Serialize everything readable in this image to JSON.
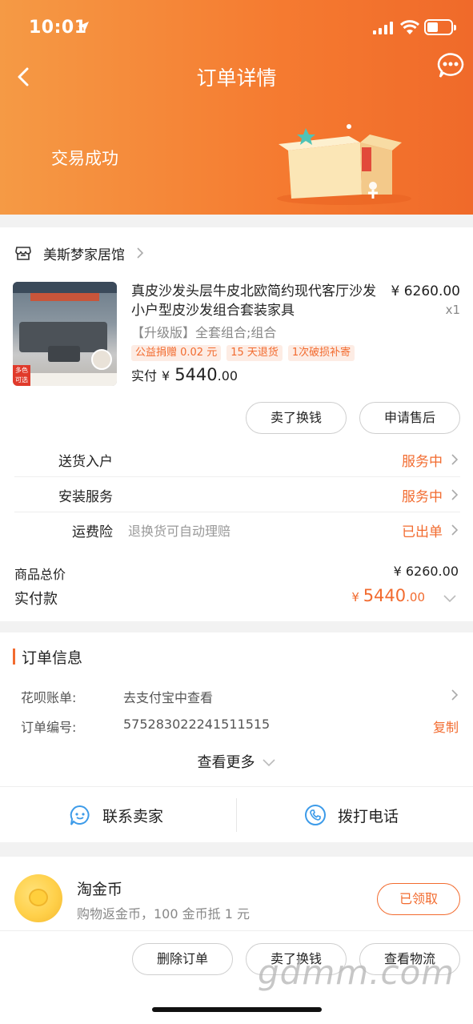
{
  "status_bar": {
    "time": "10:01"
  },
  "nav": {
    "title": "订单详情"
  },
  "header": {
    "status": "交易成功"
  },
  "shop": {
    "name": "美斯梦家居馆"
  },
  "product": {
    "title": "真皮沙发头层牛皮北欧简约现代客厅沙发小户型皮沙发组合套装家具",
    "price": "¥ 6260.00",
    "qty": "x1",
    "sku": "【升级版】全套组合;组合",
    "tags": [
      "公益捐赠 0.02 元",
      "15 天退货",
      "1次破损补寄"
    ],
    "paid_label": "实付",
    "paid_currency": "¥",
    "paid_int": "5440",
    "paid_dec": ".00",
    "thumb_tag": "多色可选"
  },
  "actions": {
    "sell": "卖了换钱",
    "after_sale": "申请售后"
  },
  "services": [
    {
      "label": "送货入户",
      "desc": "",
      "status": "服务中"
    },
    {
      "label": "安装服务",
      "desc": "",
      "status": "服务中"
    },
    {
      "label": "运费险",
      "desc": "退换货可自动理赔",
      "status": "已出单"
    }
  ],
  "totals": {
    "goods_label": "商品总价",
    "goods_value": "¥ 6260.00",
    "paid_label": "实付款",
    "paid_currency": "¥",
    "paid_int": "5440",
    "paid_dec": ".00"
  },
  "order_info": {
    "title": "订单信息",
    "rows": [
      {
        "key": "花呗账单:",
        "value": "去支付宝中查看",
        "action": ""
      },
      {
        "key": "订单编号:",
        "value": "575283022241511515",
        "action": "复制"
      }
    ],
    "more": "查看更多",
    "contact_seller": "联系卖家",
    "call": "拨打电话"
  },
  "coins": {
    "title": "淘金币",
    "subtitle": "购物返金币，100 金币抵 1 元",
    "button": "已领取"
  },
  "footer_actions": {
    "delete": "删除订单",
    "sell": "卖了换钱",
    "logistics": "查看物流"
  },
  "watermark": "gdmm.com",
  "colors": {
    "accent": "#f26b2f",
    "header_start": "#f59a45",
    "header_end": "#f06a2a"
  }
}
